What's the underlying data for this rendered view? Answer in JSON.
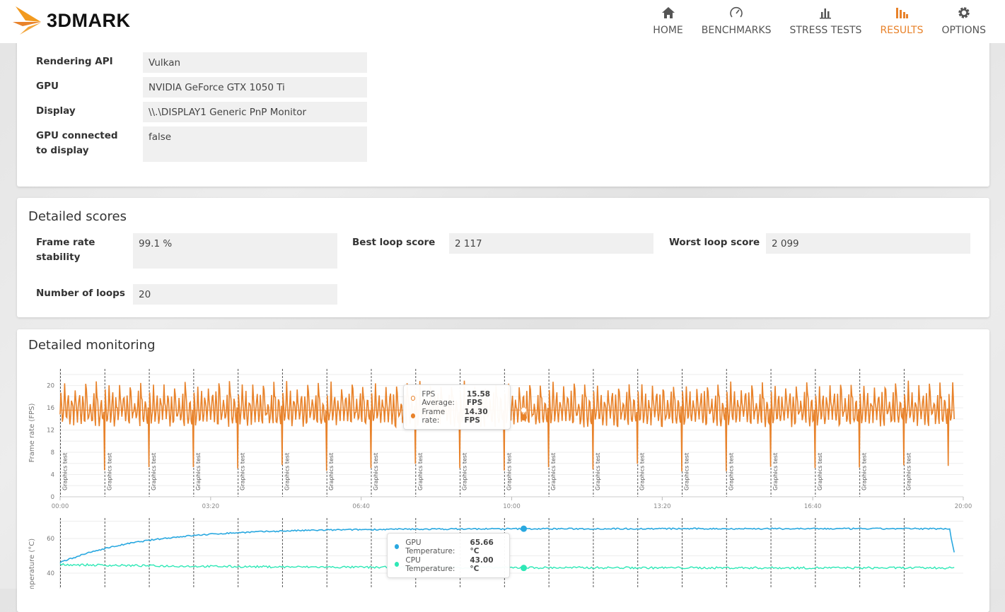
{
  "header": {
    "brand": "3DMARK",
    "nav": [
      {
        "label": "HOME",
        "icon": "home-icon"
      },
      {
        "label": "BENCHMARKS",
        "icon": "gauge-icon"
      },
      {
        "label": "STRESS TESTS",
        "icon": "bar-chart-icon"
      },
      {
        "label": "RESULTS",
        "icon": "results-icon",
        "active": true
      },
      {
        "label": "OPTIONS",
        "icon": "gear-icon"
      }
    ]
  },
  "system_info": [
    {
      "label": "Rendering API",
      "value": "Vulkan"
    },
    {
      "label": "GPU",
      "value": "NVIDIA GeForce GTX 1050 Ti"
    },
    {
      "label": "Display",
      "value": "\\\\.\\DISPLAY1 Generic PnP Monitor"
    },
    {
      "label": "GPU connected to display",
      "value": "false"
    }
  ],
  "detailed_scores": {
    "title": "Detailed scores",
    "items": [
      {
        "label": "Frame rate stability",
        "value": "99.1 %"
      },
      {
        "label": "Best loop score",
        "value": "2 117"
      },
      {
        "label": "Worst loop score",
        "value": "2 099"
      },
      {
        "label": "Number of loops",
        "value": "20"
      }
    ]
  },
  "monitoring": {
    "title": "Detailed monitoring",
    "marker_label": "Graphics test",
    "fps_tooltip": {
      "avg_label": "FPS Average:",
      "avg_value": "15.58 FPS",
      "rate_label": "Frame rate:",
      "rate_value": "14.30 FPS"
    },
    "temp_tooltip": {
      "gpu_label": "GPU Temperature:",
      "gpu_value": "65.66 °C",
      "cpu_label": "CPU Temperature:",
      "cpu_value": "43.00 °C"
    }
  },
  "chart_data": [
    {
      "type": "line",
      "ylabel": "Frame rate (FPS)",
      "ylim": [
        0,
        23
      ],
      "yticks": [
        "0",
        "4",
        "8",
        "12",
        "16",
        "20"
      ],
      "xlim_seconds": [
        0,
        1200
      ],
      "xticks": [
        "00:00",
        "03:20",
        "06:40",
        "10:00",
        "13:20",
        "16:40",
        "20:00"
      ],
      "loops": 20,
      "loop_seconds": 59,
      "series": [
        {
          "name": "Frame rate",
          "color": "#e8822a",
          "mean": 15.58,
          "min": 4.3,
          "max": 20.6,
          "loop_start_dip": 4.5
        },
        {
          "name": "FPS Average",
          "color": "#f4b27a",
          "value": 15.58
        }
      ],
      "hover_x_seconds": 616
    },
    {
      "type": "line",
      "ylabel": "Temperature (°C)",
      "yticks": [
        "40",
        "60"
      ],
      "ylim": [
        34,
        72
      ],
      "series": [
        {
          "name": "GPU Temperature",
          "color": "#29a8e0",
          "start": 46,
          "plateau": 65.66,
          "end": 52
        },
        {
          "name": "CPU Temperature",
          "color": "#2ee8b6",
          "start": 45,
          "plateau": 43.0
        }
      ]
    }
  ]
}
